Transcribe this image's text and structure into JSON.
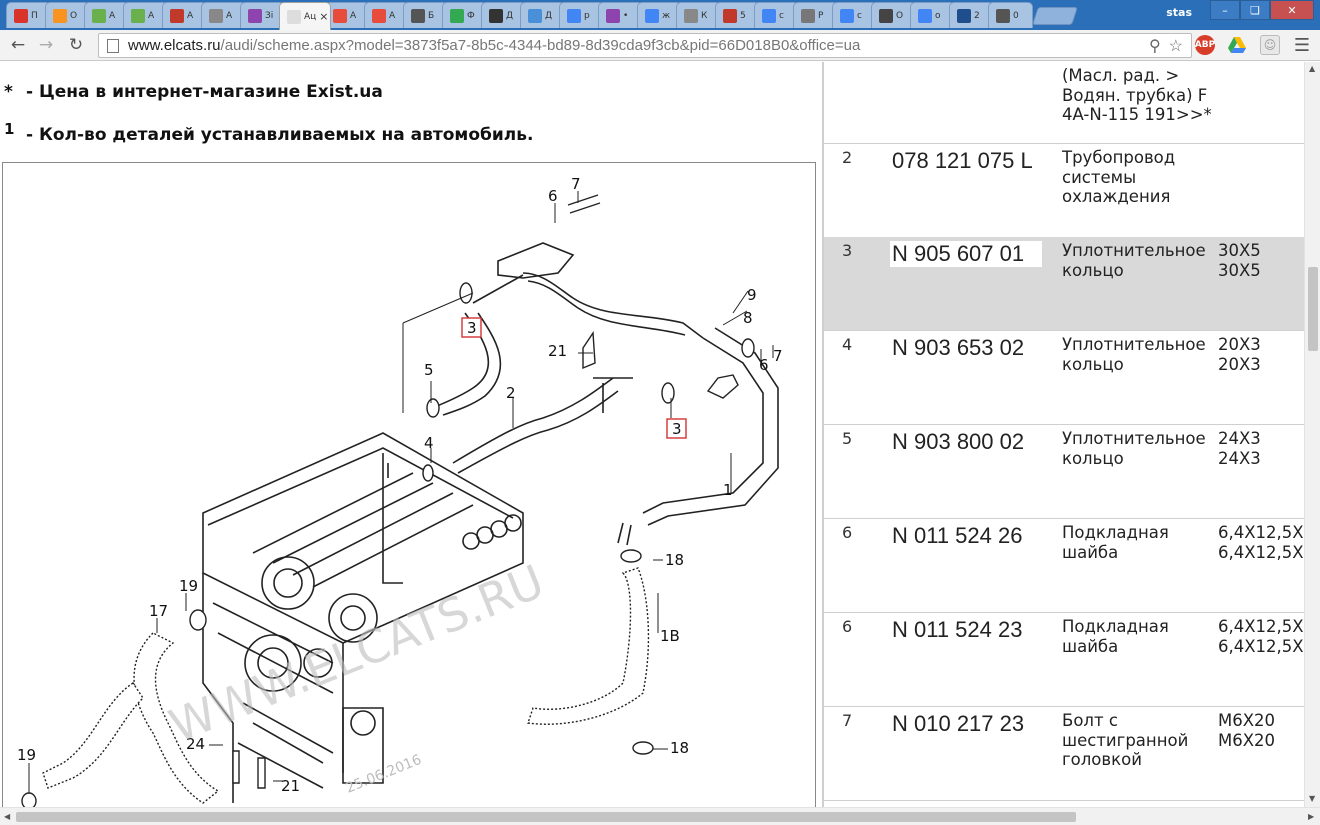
{
  "browser": {
    "tabs": [
      {
        "label": "П",
        "icon": "d-icon",
        "color": "#d9342b",
        "active": false
      },
      {
        "label": "О",
        "icon": "ok-icon",
        "color": "#f7931e",
        "active": false
      },
      {
        "label": "А",
        "icon": "drive2-icon",
        "color": "#6ab04c",
        "active": false
      },
      {
        "label": "А",
        "icon": "drive2-icon",
        "color": "#6ab04c",
        "active": false
      },
      {
        "label": "А",
        "icon": "site-icon",
        "color": "#c0392b",
        "active": false
      },
      {
        "label": "А",
        "icon": "page-icon",
        "color": "#888888",
        "active": false
      },
      {
        "label": "Зі",
        "icon": "site-icon",
        "color": "#8e44ad",
        "active": false
      },
      {
        "label": "Ац",
        "icon": "page-icon",
        "color": "#dddddd",
        "active": true
      },
      {
        "label": "А",
        "icon": "car-icon",
        "color": "#e74c3c",
        "active": false
      },
      {
        "label": "А",
        "icon": "car-icon",
        "color": "#e74c3c",
        "active": false
      },
      {
        "label": "Б",
        "icon": "site-icon",
        "color": "#555555",
        "active": false
      },
      {
        "label": "Ф",
        "icon": "drive-icon",
        "color": "#34a853",
        "active": false
      },
      {
        "label": "Д",
        "icon": "face-icon",
        "color": "#333333",
        "active": false
      },
      {
        "label": "Д",
        "icon": "chat-icon",
        "color": "#4a90d9",
        "active": false
      },
      {
        "label": "р",
        "icon": "google-icon",
        "color": "#4285f4",
        "active": false
      },
      {
        "label": "•",
        "icon": "puzzle-icon",
        "color": "#8e44ad",
        "active": false
      },
      {
        "label": "ж",
        "icon": "google-icon",
        "color": "#4285f4",
        "active": false
      },
      {
        "label": "К",
        "icon": "page-icon",
        "color": "#888888",
        "active": false
      },
      {
        "label": "5",
        "icon": "steering-icon",
        "color": "#c0392b",
        "active": false
      },
      {
        "label": "с",
        "icon": "google-icon",
        "color": "#4285f4",
        "active": false
      },
      {
        "label": "Р",
        "icon": "ex-icon",
        "color": "#777777",
        "active": false
      },
      {
        "label": "с",
        "icon": "google-icon",
        "color": "#4285f4",
        "active": false
      },
      {
        "label": "О",
        "icon": "site-icon",
        "color": "#444444",
        "active": false
      },
      {
        "label": "о",
        "icon": "google-icon",
        "color": "#4285f4",
        "active": false
      },
      {
        "label": "2",
        "icon": "vw-icon",
        "color": "#1f4e8c",
        "active": false
      },
      {
        "label": "0",
        "icon": "site-icon",
        "color": "#555555",
        "active": false
      }
    ],
    "active_tab_close": "×",
    "profile_name": "stas",
    "url_host": "www.elcats.ru",
    "url_path": "/audi/scheme.aspx?model=3873f5a7-8b5c-4344-bd89-8d39cda9f3cb&pid=66D018B0&office=ua",
    "ext_abp": "ABP"
  },
  "notes": {
    "note1_mark": "*",
    "note1_text": "- Цена в интернет-магазине Exist.ua",
    "note2_mark": "1",
    "note2_text": "- Кол-во деталей устанавливаемых на автомобиль."
  },
  "diagram": {
    "callouts": [
      "7",
      "6",
      "9",
      "8",
      "6",
      "7",
      "3",
      "5",
      "21",
      "2",
      "4",
      "3",
      "1",
      "18",
      "1B",
      "18",
      "19",
      "17",
      "19",
      "24",
      "21"
    ],
    "watermark": "WWW.ELCATS.RU",
    "date_watermark": "25.06.2016"
  },
  "parts": {
    "top_row": {
      "pname": "(Масл. рад. > Водян. трубка) F 4A-N-115 191>>*"
    },
    "rows": [
      {
        "pos": "2",
        "partno": "078 121 075 L",
        "pname": "Трубопровод системы охлаждения",
        "qty": ""
      },
      {
        "pos": "3",
        "partno": "N 905 607 01",
        "pname": "Уплотнительное кольцо",
        "qty": "30X5\n30X5"
      },
      {
        "pos": "4",
        "partno": "N 903 653 02",
        "pname": "Уплотнительное кольцо",
        "qty": "20X3\n20X3"
      },
      {
        "pos": "5",
        "partno": "N 903 800 02",
        "pname": "Уплотнительное кольцо",
        "qty": "24X3\n24X3"
      },
      {
        "pos": "6",
        "partno": "N 011 524 26",
        "pname": "Подкладная шайба",
        "qty": "6,4X12,5X\n6,4X12,5X"
      },
      {
        "pos": "6",
        "partno": "N 011 524 23",
        "pname": "Подкладная шайба",
        "qty": "6,4X12,5X\n6,4X12,5X"
      },
      {
        "pos": "7",
        "partno": "N 010 217 23",
        "pname": "Болт с шестигранной головкой",
        "qty": "M6X20\nM6X20"
      }
    ]
  },
  "colors": {
    "tabstrip": "#2a6fb8",
    "selected_row": "#d9d9d9",
    "callout_box": "#d33333"
  }
}
